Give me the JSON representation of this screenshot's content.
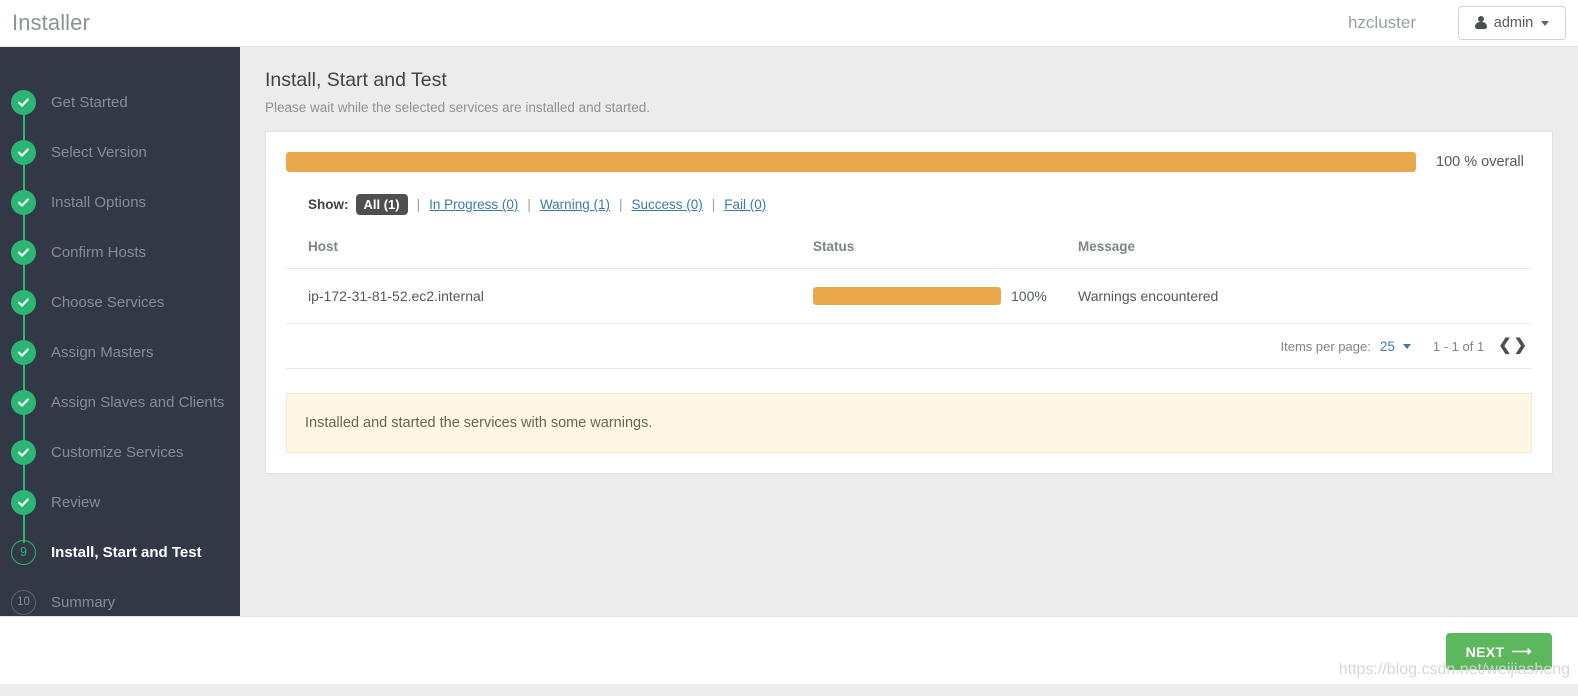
{
  "topbar": {
    "app_title": "Installer",
    "cluster_name": "hzcluster",
    "user_label": "admin",
    "user_icon": "person-icon",
    "caret_icon": "caret-down-icon"
  },
  "sidebar": {
    "steps": [
      {
        "label": "Get Started",
        "state": "done",
        "marker": "check-icon"
      },
      {
        "label": "Select Version",
        "state": "done",
        "marker": "check-icon"
      },
      {
        "label": "Install Options",
        "state": "done",
        "marker": "check-icon"
      },
      {
        "label": "Confirm Hosts",
        "state": "done",
        "marker": "check-icon"
      },
      {
        "label": "Choose Services",
        "state": "done",
        "marker": "check-icon"
      },
      {
        "label": "Assign Masters",
        "state": "done",
        "marker": "check-icon"
      },
      {
        "label": "Assign Slaves and Clients",
        "state": "done",
        "marker": "check-icon"
      },
      {
        "label": "Customize Services",
        "state": "done",
        "marker": "check-icon"
      },
      {
        "label": "Review",
        "state": "done",
        "marker": "check-icon"
      },
      {
        "label": "Install, Start and Test",
        "state": "current",
        "marker": "9"
      },
      {
        "label": "Summary",
        "state": "pending",
        "marker": "10"
      }
    ]
  },
  "main": {
    "title": "Install, Start and Test",
    "subtitle": "Please wait while the selected services are installed and started.",
    "overall": {
      "percent": 100,
      "label": "100 % overall"
    },
    "filters": {
      "show_label": "Show:",
      "separator": "|",
      "items": [
        {
          "label": "All (1)",
          "active": true
        },
        {
          "label": "In Progress (0)",
          "active": false
        },
        {
          "label": "Warning (1)",
          "active": false
        },
        {
          "label": "Success (0)",
          "active": false
        },
        {
          "label": "Fail (0)",
          "active": false
        }
      ]
    },
    "table": {
      "columns": [
        "Host",
        "Status",
        "Message"
      ],
      "rows": [
        {
          "host": "ip-172-31-81-52.ec2.internal",
          "percent": 100,
          "percent_label": "100%",
          "message": "Warnings encountered"
        }
      ]
    },
    "paginator": {
      "items_per_page_label": "Items per page:",
      "items_per_page_value": "25",
      "range": "1 - 1 of 1",
      "prev_icon": "chevron-left-icon",
      "next_icon": "chevron-right-icon"
    },
    "alert": {
      "message": "Installed and started the services with some warnings."
    }
  },
  "footer": {
    "next_label": "NEXT",
    "next_arrow": "arrow-right-icon"
  },
  "watermark": {
    "text": "https://blog.csdn.net/weijiasheng"
  },
  "colors": {
    "sidebar_bg": "#323845",
    "accent_green": "#2bb673",
    "progress_orange": "#eaa84c",
    "link_blue": "#3d7ba5",
    "alert_bg": "#fdf8e6",
    "next_green": "#5cb85c"
  }
}
